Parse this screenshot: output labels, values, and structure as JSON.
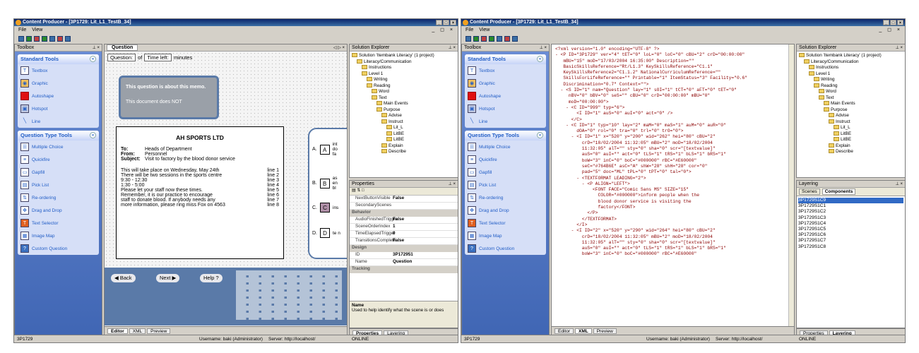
{
  "left": {
    "title": "Content Producer - [3P1729: Lit_L1_TestB_34]",
    "menu": [
      "File",
      "View"
    ],
    "toolbox": {
      "header": "Toolbox",
      "standard": {
        "title": "Standard Tools",
        "items": [
          "Textbox",
          "Graphic",
          "Autoshape",
          "Hotspot",
          "Line"
        ]
      },
      "qtypes": {
        "title": "Question Type Tools",
        "items": [
          "Multiple Choice",
          "Quickfire",
          "Gapfill",
          "Pick List",
          "Re-ordering",
          "Drag and Drop",
          "Text Selector",
          "Image Map",
          "Custom Question"
        ]
      }
    },
    "doc_tab": "Question",
    "question_bar": {
      "question": "Question:",
      "of": "of",
      "time_left": "Time left:",
      "minutes": "minutes"
    },
    "memo_note": {
      "line1": "This question is about this memo.",
      "line2": "This document does NOT"
    },
    "memo": {
      "company": "AH SPORTS LTD",
      "to_label": "To:",
      "to": "Heads of Department",
      "from_label": "From:",
      "from": "Personnel",
      "subject_label": "Subject:",
      "subject": "Visit to factory by the blood donor service",
      "lines": [
        {
          "text": "This will take place on Wednesday, May 24th",
          "num": "line 1"
        },
        {
          "text": "There will be two sessions in the sports centre",
          "num": "line 2"
        },
        {
          "text": "9:30 - 12:30",
          "num": "line 3"
        },
        {
          "text": "1:30 -  5:00",
          "num": "line 4"
        },
        {
          "text": "Please let your staff now these times.",
          "num": "line 5"
        },
        {
          "text": "Remember, it is our practice to encourage",
          "num": "line 6"
        },
        {
          "text": "staff to donate blood. If anybody needs any",
          "num": "line 7"
        },
        {
          "text": "more information, please ring miss Fox on 4563",
          "num": "line 8"
        }
      ]
    },
    "options": [
      {
        "letter": "A.",
        "box": "A",
        "text": "int do fa"
      },
      {
        "letter": "B.",
        "box": "B",
        "text": "as en bl"
      },
      {
        "letter": "C.",
        "box": "C",
        "text": "ins"
      },
      {
        "letter": "D.",
        "box": "D",
        "text": "te n"
      }
    ],
    "nav": {
      "back": "Back",
      "next": "Next",
      "help": "Help"
    },
    "bottom_tabs": [
      "Editor",
      "XML",
      "Preview"
    ],
    "solution": {
      "header": "Solution Explorer",
      "nodes": [
        {
          "label": "Solution 'Itembank Literacy' (1 project)",
          "depth": 0
        },
        {
          "label": "Literacy/Communication",
          "depth": 1
        },
        {
          "label": "Instructions",
          "depth": 2
        },
        {
          "label": "Level 1",
          "depth": 2
        },
        {
          "label": "Writing",
          "depth": 3
        },
        {
          "label": "Reading",
          "depth": 3
        },
        {
          "label": "Word",
          "depth": 4
        },
        {
          "label": "Text",
          "depth": 4
        },
        {
          "label": "Main Events",
          "depth": 5
        },
        {
          "label": "Purpose",
          "depth": 5
        },
        {
          "label": "Advise",
          "depth": 6
        },
        {
          "label": "Instruct",
          "depth": 6
        },
        {
          "label": "Lit_L",
          "depth": 7
        },
        {
          "label": "LitBE",
          "depth": 7
        },
        {
          "label": "LitBE",
          "depth": 7
        },
        {
          "label": "Explain",
          "depth": 6
        },
        {
          "label": "Describe",
          "depth": 6
        }
      ]
    },
    "properties": {
      "header": "Properties",
      "rows": [
        {
          "k": "NextButtonVisible",
          "v": "False"
        },
        {
          "k": "SecondaryScenes",
          "v": ""
        },
        {
          "cat": "Behavior"
        },
        {
          "k": "AudioFinishedTrigger",
          "v": "False"
        },
        {
          "k": "SceneOrderIndex",
          "v": "1"
        },
        {
          "k": "TimeElapsedTrigger",
          "v": "0"
        },
        {
          "k": "TransitionsComplete",
          "v": "False"
        },
        {
          "cat": "Design"
        },
        {
          "k": "ID",
          "v": "3P172951"
        },
        {
          "k": "Name",
          "v": "Question"
        },
        {
          "cat": "Tracking"
        }
      ],
      "desc_title": "Name",
      "desc": "Used to help identify what the scene is or does"
    },
    "right_tabs": [
      "Properties",
      "Layering"
    ],
    "status": {
      "id": "3P1729",
      "user": "Username: baki (Administrator)",
      "server": "Server: http://localhost/",
      "online": "ONLINE"
    }
  },
  "right": {
    "title": "Content Producer - [3P1729: Lit_L1_TestB_34]",
    "menu": [
      "File",
      "View"
    ],
    "toolbox_header": "Toolbox",
    "xml_lines": [
      "<?xml version=\"1.0\" encoding=\"UTF-8\" ?>",
      "- <P ID=\"3P1729\" ver=\"4\" tET=\"0\" loL=\"0\" loC=\"0\" cBU=\"2\" crD=\"00:00:00\"",
      "   mBU=\"15\" moD=\"17/03/2004 16:35:00\" Description=\"\"",
      "   BasicSkillsReference=\"Rt/L1.3\" KeySkillsReference=\"C1.1\"",
      "   KeySkillsReference2=\"C1.1.2\" NationalCurriculumReference=\"\"",
      "   SkillsForLifeReference=\"\" Printable=\"1\" ItemStatus=\"3\" Facility=\"0.6\"",
      "   Discrimination=\"0.7\" Context=\"\">",
      "  - <S ID=\"1\" nam=\"Question\" lay=\"1\" sOI=\"1\" tCT=\"0\" aFT=\"0\" tET=\"0\"",
      "     nBV=\"0\" bBV=\"0\" seS=\"\" cBU=\"0\" crD=\"00:00:00\" mBU=\"0\"",
      "     moD=\"00:00:00\">",
      "    - <C ID=\"999\" typ=\"6\">",
      "        <I ID=\"1\" auS=\"0\" auI=\"0\" act=\"0\" />",
      "      </C>",
      "    - <C ID=\"1\" typ=\"10\" lay=\"2\" maM=\"0\" maS=\"1\" auM=\"0\" auR=\"0\"",
      "        dOA=\"0\" rol=\"0\" tra=\"0\" trl=\"0\" trO=\"0\">",
      "      - <I ID=\"1\" x=\"520\" y=\"200\" wid=\"262\" hei=\"80\" cBU=\"2\"",
      "          crD=\"18/02/2004 11:32:05\" mBU=\"2\" moD=\"18/02/2004",
      "          11:32:05\" alT=\"\" sty=\"0\" sha=\"0\" scr=\"[textvalue]\"",
      "          auS=\"0\" auI=\"\" act=\"0\" tLS=\"1\" tRS=\"1\" bLS=\"1\" bRS=\"1\"",
      "          boW=\"3\" inC=\"0\" boC=\"#000000\" rBC=\"#E60000\"",
      "          seC=\"#764B6E\" asC=\"A\" shW=\"28\" shH=\"28\" cor=\"0\"",
      "          pad=\"5\" doc=\"ML\" tPL=\"0\" tPT=\"0\" tal=\"0\">",
      "        - <TEXTFORMAT LEADING=\"2\">",
      "          - <P ALIGN=\"LEFT\">",
      "              <FONT FACE=\"Comic Sans MS\" SIZE=\"15\"",
      "                COLOR=\"#000000\">inform people when the",
      "                blood donor service is visiting the",
      "                factory</FONT>",
      "            </P>",
      "          </TEXTFORMAT>",
      "        </I>",
      "      - <I ID=\"2\" x=\"520\" y=\"290\" wid=\"264\" hei=\"80\" cBU=\"2\"",
      "          crD=\"18/02/2004 11:32:05\" mBU=\"2\" moD=\"18/02/2004",
      "          11:32:05\" alT=\"\" sty=\"0\" sha=\"0\" scr=\"[textvalue]\"",
      "          auS=\"0\" auI=\"\" act=\"0\" tLS=\"1\" tRS=\"1\" bLS=\"1\" bRS=\"1\"",
      "          boW=\"3\" inC=\"0\" boC=\"#000000\" rBC=\"#E60000\""
    ],
    "layering": {
      "header": "Layering",
      "tabs": [
        "Scenes",
        "Components"
      ],
      "scenes": [
        "3P1729S1C9",
        "3P1729S1C1",
        "3P1729S1C2",
        "3P1729S1C3",
        "3P1729S1C4",
        "3P1729S1C5",
        "3P1729S1C6",
        "3P1729S1C7",
        "3P1729S1C8"
      ]
    },
    "bottom_tabs": [
      "Editor",
      "XML",
      "Preview"
    ],
    "right_tabs": [
      "Properties",
      "Layering"
    ],
    "status": {
      "id": "3P1729",
      "user": "Username: baki (Administrator)",
      "server": "Server: http://localhost/",
      "online": "ONLINE"
    }
  }
}
